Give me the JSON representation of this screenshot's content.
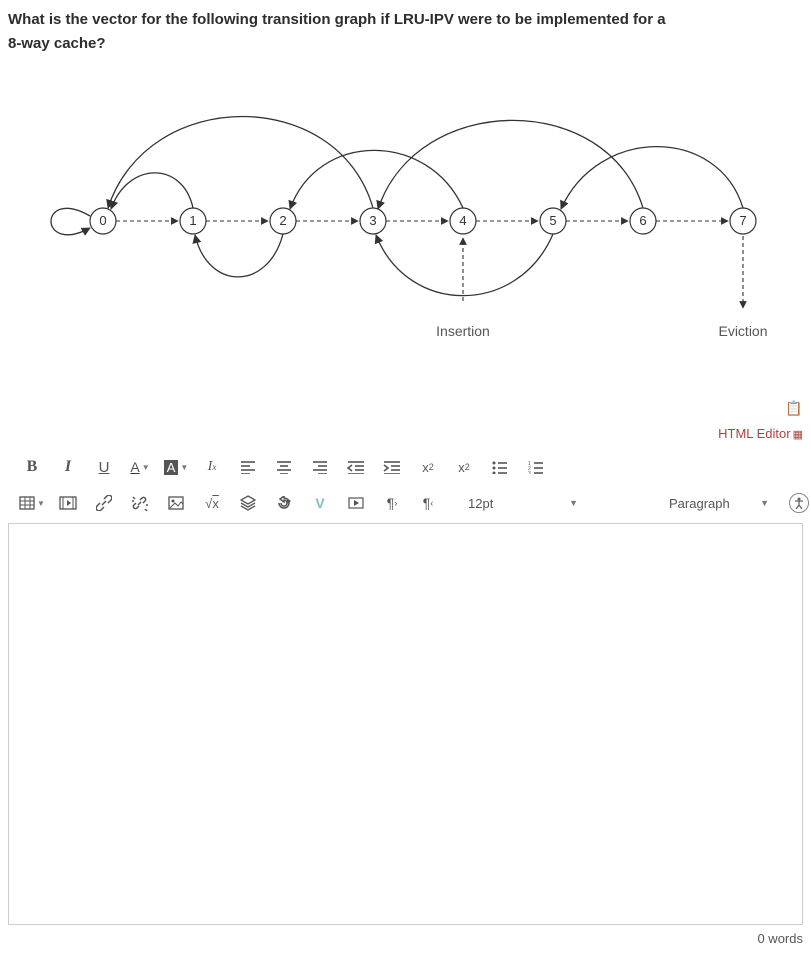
{
  "question": {
    "line1": "What is the vector for the following transition graph if LRU-IPV were to be implemented for a",
    "line2": "8-way cache?"
  },
  "graph": {
    "nodes": [
      "0",
      "1",
      "2",
      "3",
      "4",
      "5",
      "6",
      "7"
    ],
    "insertion_label": "Insertion",
    "eviction_label": "Eviction"
  },
  "editor": {
    "html_editor_label": "HTML Editor",
    "font_size": "12pt",
    "block_format": "Paragraph",
    "word_count": "0 words"
  },
  "icons": {
    "bold": "B",
    "italic": "I",
    "underline": "U",
    "textcolor": "A",
    "bgcolor": "A",
    "clear": "Tx",
    "alignL": "align-left",
    "alignC": "align-center",
    "alignR": "align-right",
    "outdent": "outdent",
    "indent": "indent",
    "sup": "x²",
    "sub": "x₂",
    "ul": "ul",
    "ol": "ol",
    "table": "table",
    "media": "media",
    "link": "link",
    "unlink": "unlink",
    "image": "image",
    "math": "√x",
    "layers": "layers",
    "redo": "redo",
    "down": "v",
    "video": "video",
    "ltr": "¶",
    "rtl": "¶",
    "access": "accessibility"
  }
}
